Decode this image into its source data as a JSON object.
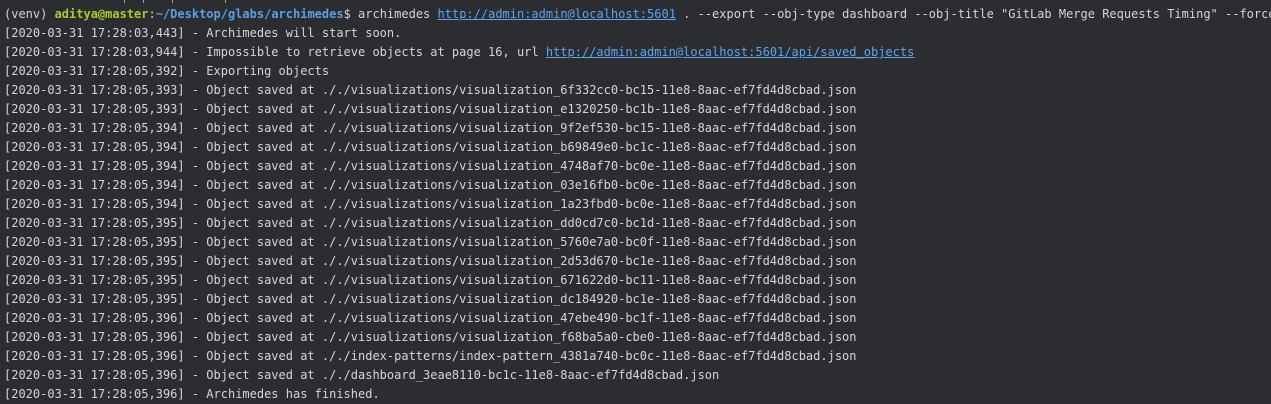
{
  "prompt": {
    "venv": "(venv) ",
    "user_host": "aditya@master",
    "sep": ":",
    "path": "~/Desktop/glabs/archimedes",
    "symbol": "$ ",
    "cmd_start": "archimedes ",
    "url": "http://admin:admin@localhost:5601",
    "cmd_end": " . --export --obj-type dashboard --obj-title \"GitLab Merge Requests Timing\" --force"
  },
  "log": [
    {
      "text": "[2020-03-31 17:28:03,443] - Archimedes will start soon."
    },
    {
      "text": "[2020-03-31 17:28:03,944] - Impossible to retrieve objects at page 16, url ",
      "link": "http://admin:admin@localhost:5601/api/saved_objects"
    },
    {
      "text": "[2020-03-31 17:28:05,392] - Exporting objects"
    },
    {
      "text": "[2020-03-31 17:28:05,393] - Object saved at ././visualizations/visualization_6f332cc0-bc15-11e8-8aac-ef7fd4d8cbad.json"
    },
    {
      "text": "[2020-03-31 17:28:05,393] - Object saved at ././visualizations/visualization_e1320250-bc1b-11e8-8aac-ef7fd4d8cbad.json"
    },
    {
      "text": "[2020-03-31 17:28:05,394] - Object saved at ././visualizations/visualization_9f2ef530-bc15-11e8-8aac-ef7fd4d8cbad.json"
    },
    {
      "text": "[2020-03-31 17:28:05,394] - Object saved at ././visualizations/visualization_b69849e0-bc1c-11e8-8aac-ef7fd4d8cbad.json"
    },
    {
      "text": "[2020-03-31 17:28:05,394] - Object saved at ././visualizations/visualization_4748af70-bc0e-11e8-8aac-ef7fd4d8cbad.json"
    },
    {
      "text": "[2020-03-31 17:28:05,394] - Object saved at ././visualizations/visualization_03e16fb0-bc0e-11e8-8aac-ef7fd4d8cbad.json"
    },
    {
      "text": "[2020-03-31 17:28:05,394] - Object saved at ././visualizations/visualization_1a23fbd0-bc0e-11e8-8aac-ef7fd4d8cbad.json"
    },
    {
      "text": "[2020-03-31 17:28:05,395] - Object saved at ././visualizations/visualization_dd0cd7c0-bc1d-11e8-8aac-ef7fd4d8cbad.json"
    },
    {
      "text": "[2020-03-31 17:28:05,395] - Object saved at ././visualizations/visualization_5760e7a0-bc0f-11e8-8aac-ef7fd4d8cbad.json"
    },
    {
      "text": "[2020-03-31 17:28:05,395] - Object saved at ././visualizations/visualization_2d53d670-bc1e-11e8-8aac-ef7fd4d8cbad.json"
    },
    {
      "text": "[2020-03-31 17:28:05,395] - Object saved at ././visualizations/visualization_671622d0-bc11-11e8-8aac-ef7fd4d8cbad.json"
    },
    {
      "text": "[2020-03-31 17:28:05,395] - Object saved at ././visualizations/visualization_dc184920-bc1e-11e8-8aac-ef7fd4d8cbad.json"
    },
    {
      "text": "[2020-03-31 17:28:05,396] - Object saved at ././visualizations/visualization_47ebe490-bc1f-11e8-8aac-ef7fd4d8cbad.json"
    },
    {
      "text": "[2020-03-31 17:28:05,396] - Object saved at ././visualizations/visualization_f68ba5a0-cbe0-11e8-8aac-ef7fd4d8cbad.json"
    },
    {
      "text": "[2020-03-31 17:28:05,396] - Object saved at ././index-patterns/index-pattern_4381a740-bc0c-11e8-8aac-ef7fd4d8cbad.json"
    },
    {
      "text": "[2020-03-31 17:28:05,396] - Object saved at ././dashboard_3eae8110-bc1c-11e8-8aac-ef7fd4d8cbad.json"
    },
    {
      "text": "[2020-03-31 17:28:05,396] - Archimedes has finished."
    }
  ],
  "colors": {
    "background": "#2b2d30",
    "text": "#d3d6d9",
    "user_host": "#a6cc2e",
    "path": "#5d9ee8",
    "link": "#5aa5f0"
  }
}
